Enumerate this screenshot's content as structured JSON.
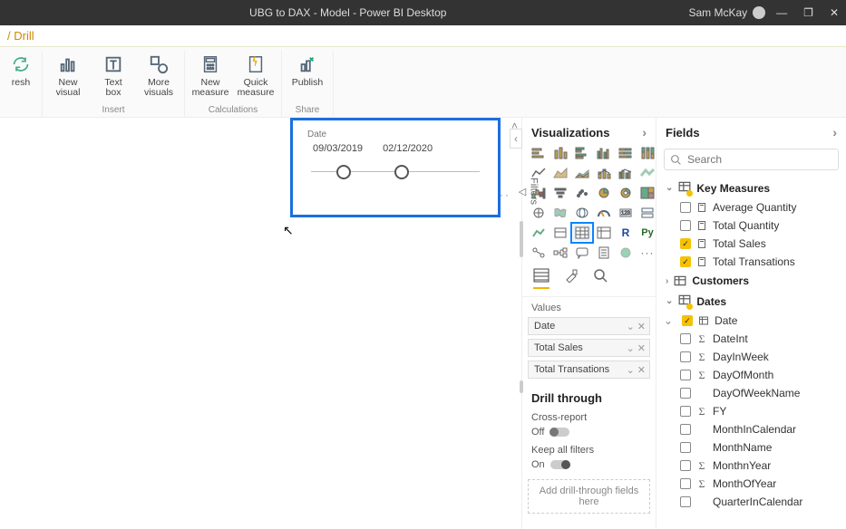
{
  "titlebar": {
    "title": "UBG to DAX - Model - Power BI Desktop",
    "user": "Sam McKay"
  },
  "drillbar": {
    "text": "/ Drill"
  },
  "ribbon": {
    "refresh": "resh",
    "new_visual": "New\nvisual",
    "text_box": "Text\nbox",
    "more_visuals": "More\nvisuals",
    "new_measure": "New\nmeasure",
    "quick_measure": "Quick\nmeasure",
    "publish": "Publish",
    "grp_insert": "Insert",
    "grp_calc": "Calculations",
    "grp_share": "Share"
  },
  "slicer": {
    "caption": "Date",
    "from": "09/03/2019",
    "to": "02/12/2020"
  },
  "collapse_chev": "‹",
  "filters_label": "Filters",
  "viz": {
    "header": "Visualizations",
    "values_label": "Values",
    "wells": [
      "Date",
      "Total Sales",
      "Total Transations"
    ],
    "drill_header": "Drill through",
    "cross_report_label": "Cross-report",
    "off": "Off",
    "keep_filters_label": "Keep all filters",
    "on": "On",
    "dropzone": "Add drill-through fields here",
    "row6": {
      "r": "R",
      "py": "Py",
      "dots": "···"
    }
  },
  "fields": {
    "header": "Fields",
    "search_placeholder": "Search",
    "groups": {
      "key_measures": {
        "label": "Key Measures",
        "items": [
          {
            "label": "Average Quantity",
            "checked": false,
            "icon": "calc"
          },
          {
            "label": "Total Quantity",
            "checked": false,
            "icon": "calc"
          },
          {
            "label": "Total Sales",
            "checked": true,
            "icon": "calc"
          },
          {
            "label": "Total Transations",
            "checked": true,
            "icon": "calc"
          }
        ]
      },
      "customers": {
        "label": "Customers"
      },
      "dates": {
        "label": "Dates",
        "items": [
          {
            "label": "Date",
            "checked": true,
            "icon": "table"
          },
          {
            "label": "DateInt",
            "checked": false,
            "icon": "sigma"
          },
          {
            "label": "DayInWeek",
            "checked": false,
            "icon": "sigma"
          },
          {
            "label": "DayOfMonth",
            "checked": false,
            "icon": "sigma"
          },
          {
            "label": "DayOfWeekName",
            "checked": false,
            "icon": "none"
          },
          {
            "label": "FY",
            "checked": false,
            "icon": "sigma"
          },
          {
            "label": "MonthInCalendar",
            "checked": false,
            "icon": "none"
          },
          {
            "label": "MonthName",
            "checked": false,
            "icon": "none"
          },
          {
            "label": "MonthnYear",
            "checked": false,
            "icon": "sigma"
          },
          {
            "label": "MonthOfYear",
            "checked": false,
            "icon": "sigma"
          },
          {
            "label": "QuarterInCalendar",
            "checked": false,
            "icon": "none"
          }
        ]
      }
    }
  }
}
